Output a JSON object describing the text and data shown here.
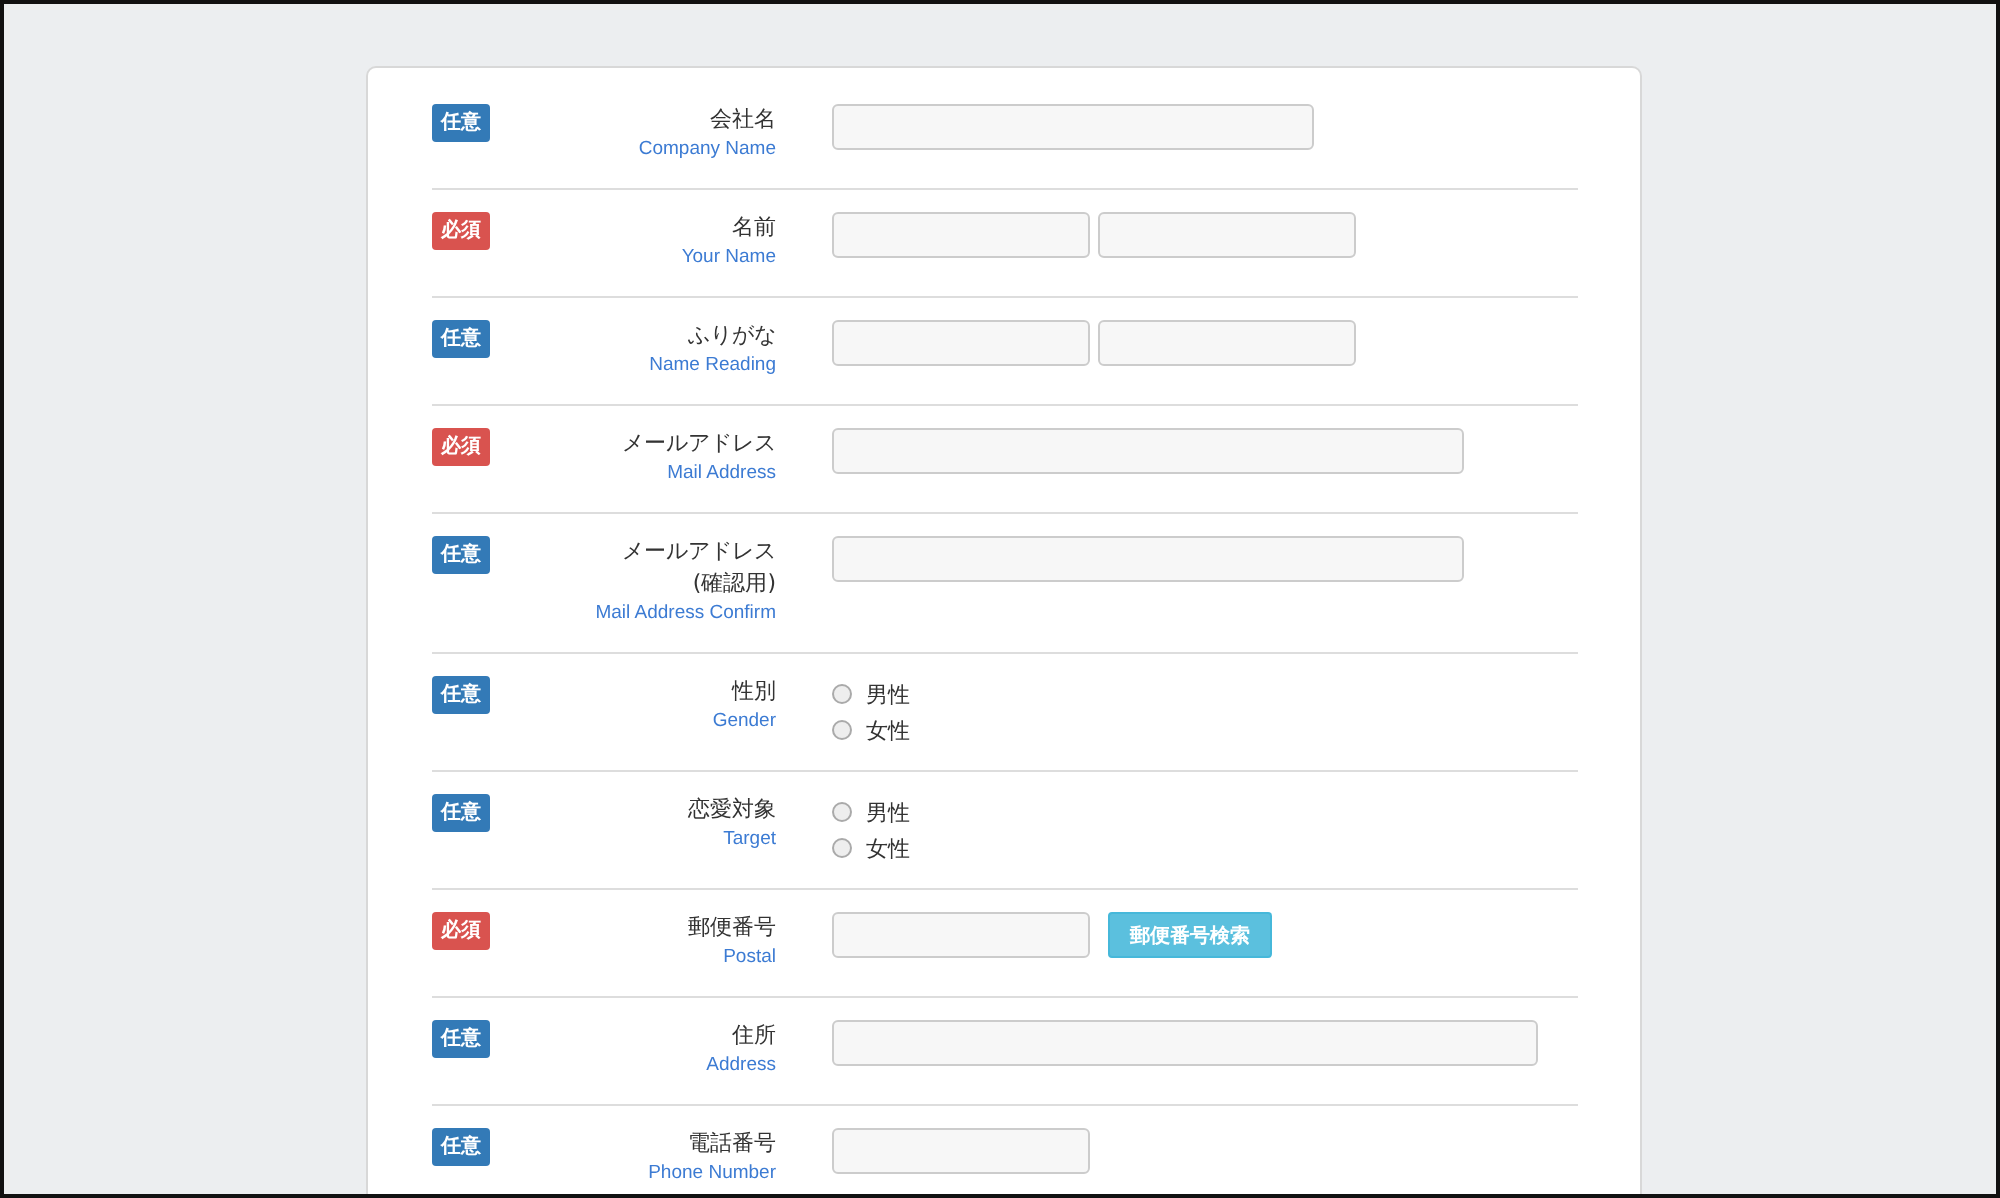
{
  "rows": [
    {
      "badge": {
        "kind": "optional",
        "text": "任意"
      },
      "label": [
        "会社名"
      ],
      "label_en": "Company Name",
      "fields": [
        {
          "kind": "medium"
        }
      ]
    },
    {
      "badge": {
        "kind": "required",
        "text": "必須"
      },
      "label": [
        "名前"
      ],
      "label_en": "Your Name",
      "fields": [
        {
          "kind": "short"
        },
        {
          "kind": "short"
        }
      ]
    },
    {
      "badge": {
        "kind": "optional",
        "text": "任意"
      },
      "label": [
        "ふりがな"
      ],
      "label_en": "Name Reading",
      "fields": [
        {
          "kind": "short"
        },
        {
          "kind": "short"
        }
      ]
    },
    {
      "badge": {
        "kind": "required",
        "text": "必須"
      },
      "label": [
        "メールアドレス"
      ],
      "label_en": "Mail Address",
      "fields": [
        {
          "kind": "long"
        }
      ]
    },
    {
      "badge": {
        "kind": "optional",
        "text": "任意"
      },
      "label": [
        "メールアドレス",
        "(確認用)"
      ],
      "label_en": "Mail Address Confirm",
      "fields": [
        {
          "kind": "long"
        }
      ]
    },
    {
      "badge": {
        "kind": "optional",
        "text": "任意"
      },
      "label": [
        "性別"
      ],
      "label_en": "Gender",
      "fields": [
        {
          "kind": "radios",
          "options": [
            {
              "label": "男性",
              "selected": false
            },
            {
              "label": "女性",
              "selected": false
            }
          ]
        }
      ]
    },
    {
      "badge": {
        "kind": "optional",
        "text": "任意"
      },
      "label": [
        "恋愛対象"
      ],
      "label_en": "Target",
      "fields": [
        {
          "kind": "radios",
          "options": [
            {
              "label": "男性",
              "selected": false
            },
            {
              "label": "女性",
              "selected": false
            }
          ]
        }
      ]
    },
    {
      "badge": {
        "kind": "required",
        "text": "必須"
      },
      "label": [
        "郵便番号"
      ],
      "label_en": "Postal",
      "fields": [
        {
          "kind": "short"
        },
        {
          "kind": "button",
          "text": "郵便番号検索"
        }
      ]
    },
    {
      "badge": {
        "kind": "optional",
        "text": "任意"
      },
      "label": [
        "住所"
      ],
      "label_en": "Address",
      "fields": [
        {
          "kind": "wide"
        }
      ]
    },
    {
      "badge": {
        "kind": "optional",
        "text": "任意"
      },
      "label": [
        "電話番号"
      ],
      "label_en": "Phone Number",
      "fields": [
        {
          "kind": "short"
        }
      ]
    }
  ]
}
